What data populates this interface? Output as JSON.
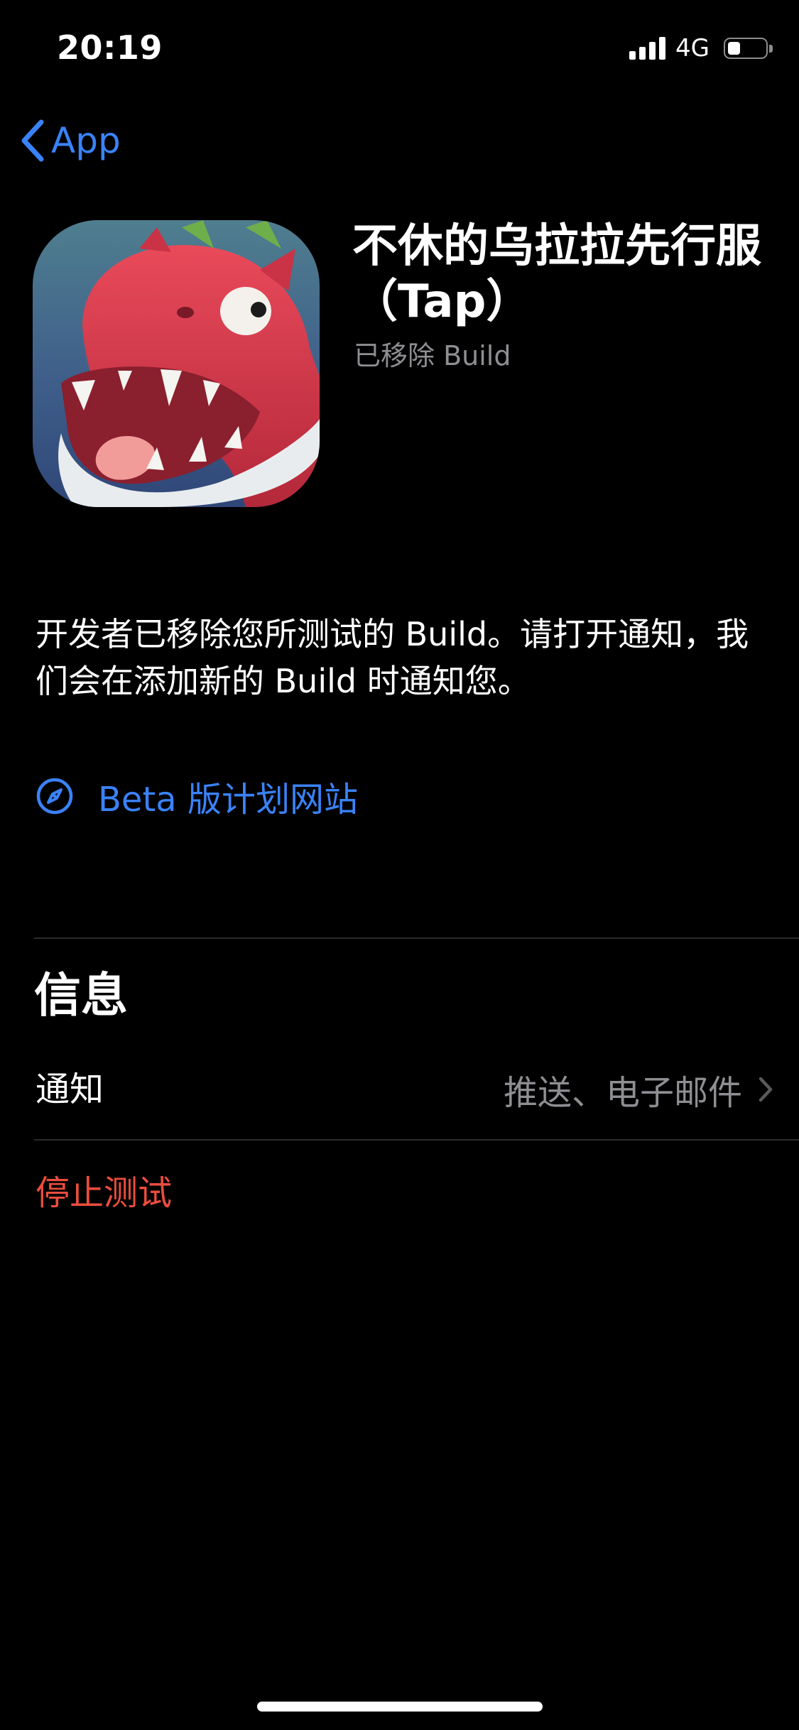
{
  "status_bar": {
    "time": "20:19",
    "network": "4G",
    "signal_bars": 4,
    "battery_level": 0.35
  },
  "nav": {
    "back_label": "App",
    "back_icon": "chevron-left-icon",
    "accent_color": "#3a82f7"
  },
  "app": {
    "icon": "dinosaur-app-icon",
    "title": "不休的乌拉拉先行服（Tap）",
    "status": "已移除 Build"
  },
  "description": "开发者已移除您所测试的 Build。请打开通知，我们会在添加新的 Build 时通知您。",
  "beta_link": {
    "label": "Beta 版计划网站",
    "icon": "compass-icon"
  },
  "info_section": {
    "title": "信息",
    "rows": [
      {
        "label": "通知",
        "value": "推送、电子邮件",
        "icon": "chevron-right-icon"
      }
    ]
  },
  "stop_testing": {
    "label": "停止测试",
    "color": "#eb4d3d"
  }
}
